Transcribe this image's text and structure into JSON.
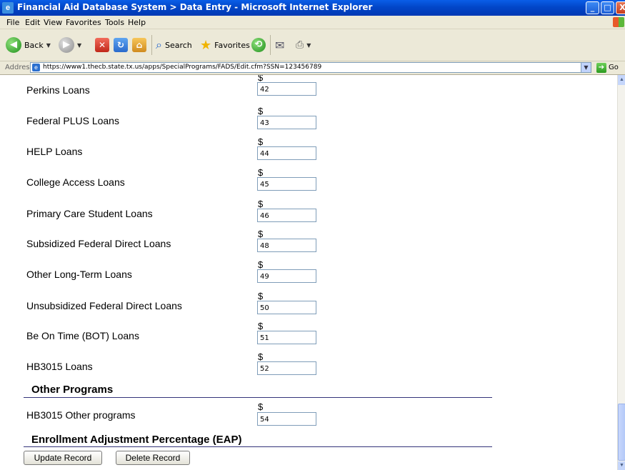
{
  "window": {
    "title": "Financial Aid Database System > Data Entry - Microsoft Internet Explorer",
    "app_icon": "ie-window-icon",
    "controls": {
      "minimize": "_",
      "maximize": "□",
      "close": "X"
    }
  },
  "menu": {
    "items": [
      "File",
      "Edit",
      "View",
      "Favorites",
      "Tools",
      "Help"
    ]
  },
  "toolbar": {
    "back_label": "Back",
    "search_label": "Search",
    "favorites_label": "Favorites"
  },
  "address": {
    "label": "Address",
    "url": "https://www1.thecb.state.tx.us/apps/SpecialPrograms/FADS/Edit.cfm?SSN=123456789",
    "go_label": "Go"
  },
  "form": {
    "currency_symbol": "$",
    "loans": [
      {
        "label": "Perkins Loans",
        "value": "42"
      },
      {
        "label": "Federal PLUS Loans",
        "value": "43"
      },
      {
        "label": "HELP Loans",
        "value": "44"
      },
      {
        "label": "College Access Loans",
        "value": "45"
      },
      {
        "label": "Primary Care Student Loans",
        "value": "46"
      },
      {
        "label": "Subsidized Federal Direct Loans",
        "value": "48"
      },
      {
        "label": "Other Long-Term Loans",
        "value": "49"
      },
      {
        "label": "Unsubsidized Federal Direct Loans",
        "value": "50"
      },
      {
        "label": "Be On Time (BOT) Loans",
        "value": "51"
      },
      {
        "label": "HB3015 Loans",
        "value": "52"
      }
    ],
    "other_programs_heading": "Other Programs",
    "other_programs": [
      {
        "label": "HB3015 Other programs",
        "value": "54"
      }
    ],
    "eap_heading": "Enrollment Adjustment Percentage (EAP)",
    "update_button": "Update Record",
    "delete_button": "Delete Record"
  },
  "colors": {
    "titlebar": "#0246c8",
    "chrome": "#ece9d8",
    "section_rule": "#33337a",
    "input_border": "#7f9db9"
  }
}
